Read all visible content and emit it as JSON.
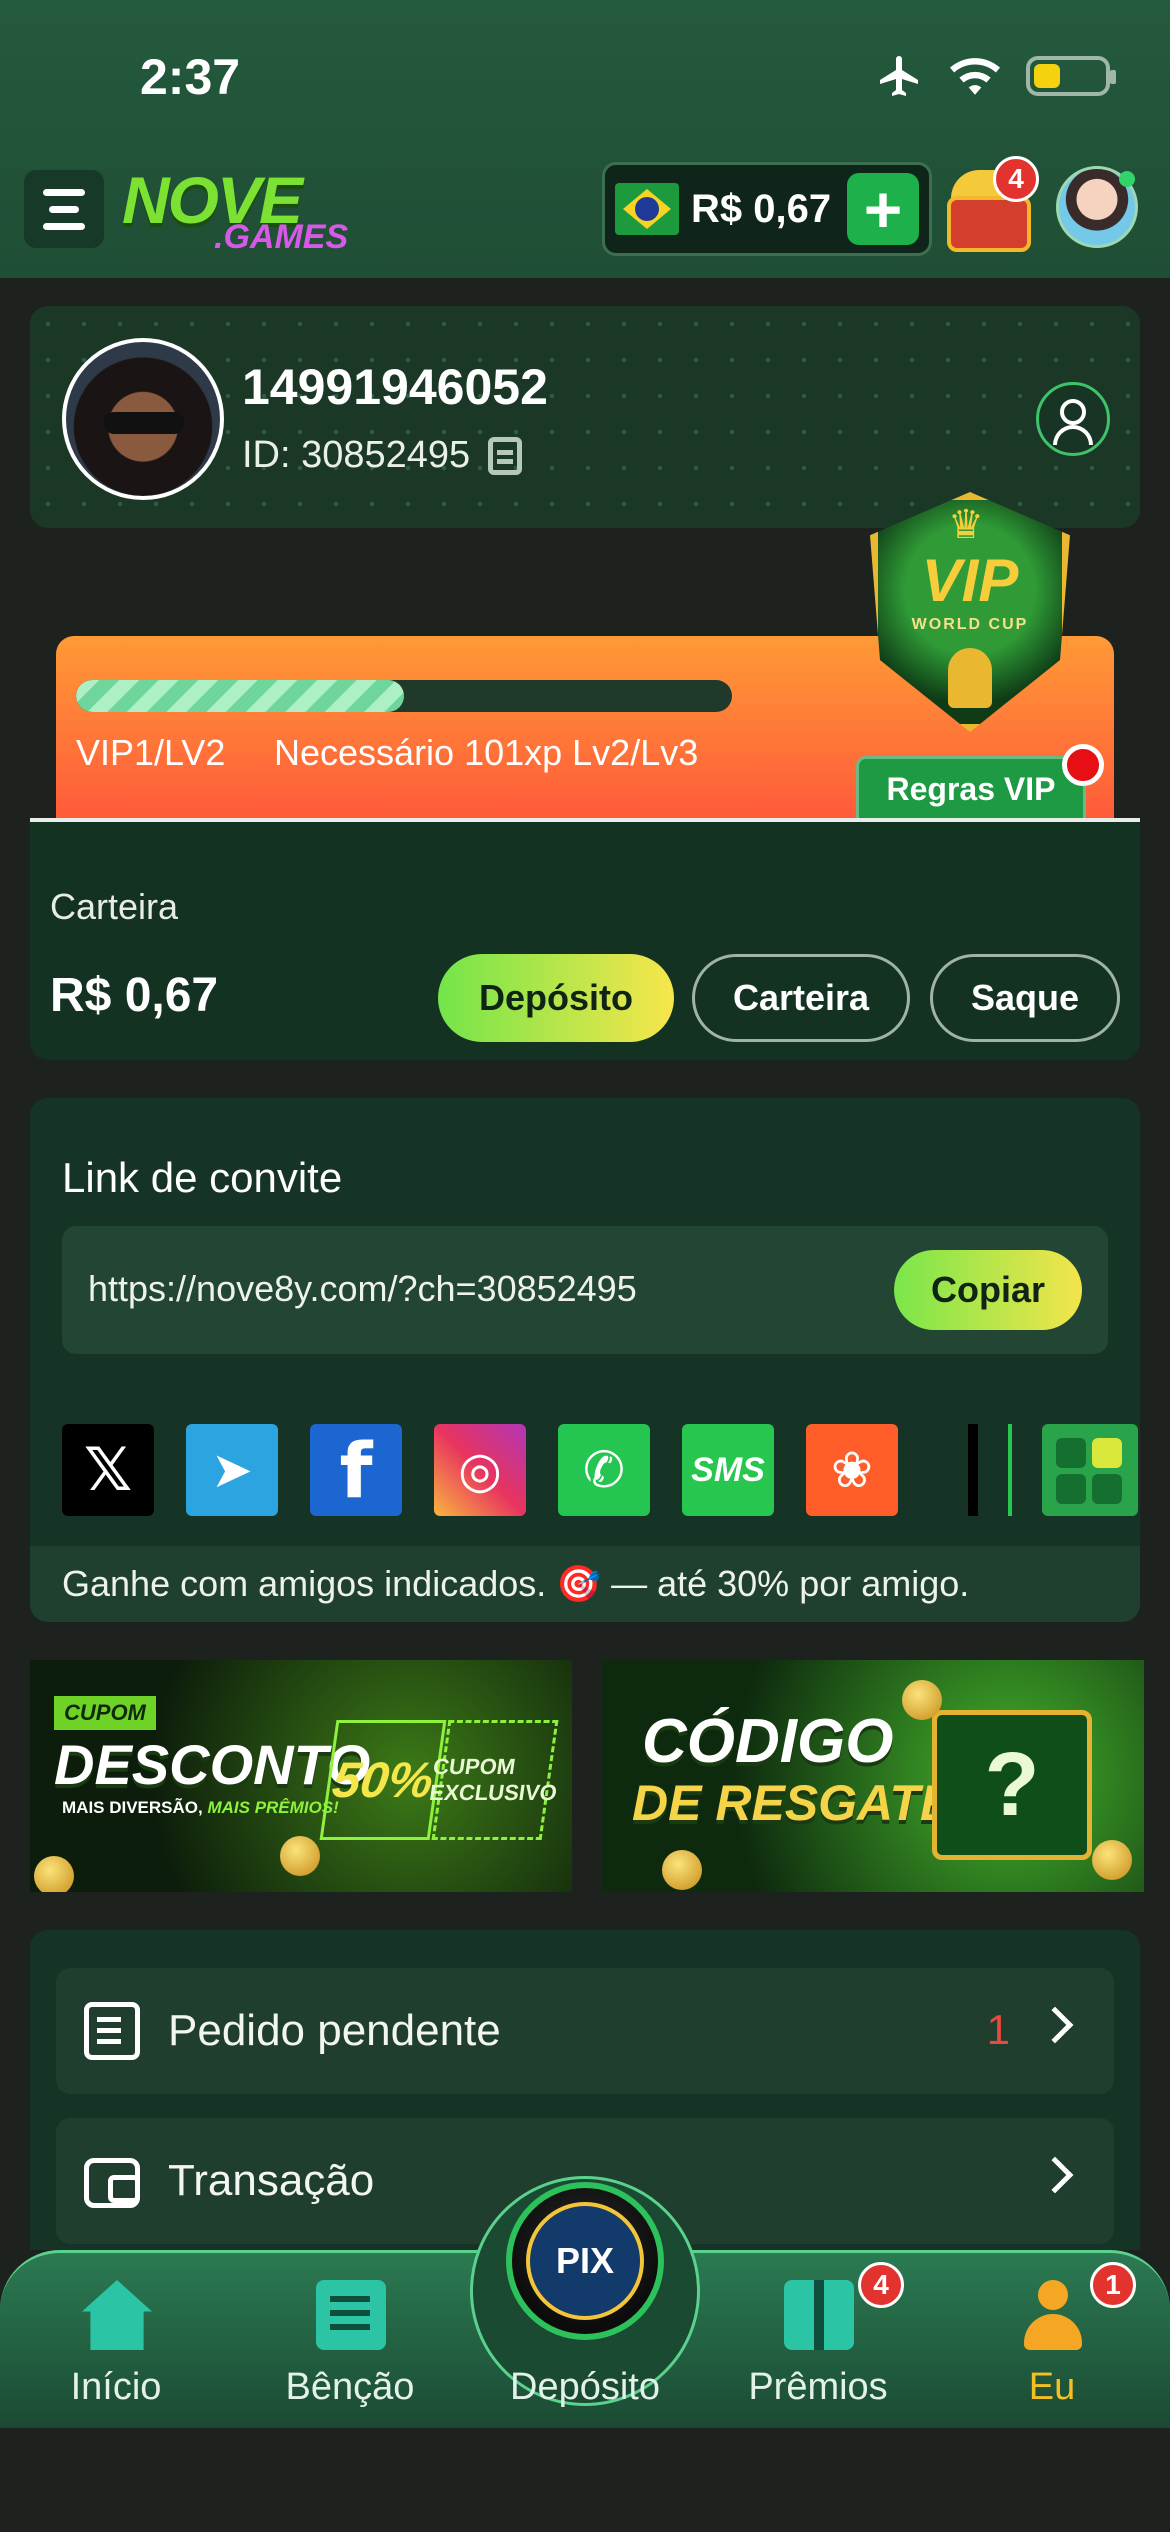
{
  "status_bar": {
    "time": "2:37",
    "icons": [
      "airplane-icon",
      "wifi-icon",
      "battery-icon"
    ],
    "battery_level": 0.25
  },
  "header": {
    "logo_top": "NOVE",
    "logo_bottom": ".GAMES",
    "balance": "R$ 0,67",
    "add_funds_symbol": "+",
    "chest_badge": "4"
  },
  "profile": {
    "username": "14991946052",
    "id_text": "ID: 30852495"
  },
  "vip": {
    "progress_fraction": 0.5,
    "level": "VIP1/LV2",
    "requirement": "Necessário 101xp Lv2/Lv3",
    "rules_button": "Regras VIP",
    "badge_title": "VIP",
    "badge_subtitle": "WORLD CUP",
    "badge_crown": "♛"
  },
  "wallet": {
    "label": "Carteira",
    "amount": "R$ 0,67",
    "buttons": {
      "deposit": "Depósito",
      "wallet": "Carteira",
      "withdraw": "Saque"
    }
  },
  "invite": {
    "title": "Link de convite",
    "url": "https://nove8y.com/?ch=30852495",
    "copy_button": "Copiar",
    "share_glyphs": {
      "x": "𝕏",
      "telegram": "➤",
      "facebook": "f",
      "instagram": "◎",
      "whatsapp": "✆",
      "sms": "SMS",
      "kwai": "❀"
    },
    "note": "Ganhe com amigos indicados. 🎯 — até 30% por amigo."
  },
  "banners": {
    "cupom": {
      "tag": "CUPOM",
      "title": "DESCONTO",
      "subtitle_plain": "MAIS DIVERSÃO, ",
      "subtitle_highlight": "MAIS PRÊMIOS!",
      "percent": "50%",
      "coupon": "CUPOM EXCLUSIVO"
    },
    "codigo": {
      "title_line1": "CÓDIGO",
      "title_line2": "DE RESGATE",
      "gift_mark": "?"
    }
  },
  "menu_list": {
    "items": [
      {
        "label": "Pedido pendente",
        "count": "1",
        "icon": "document-icon"
      },
      {
        "label": "Transação",
        "count": "",
        "icon": "wallet-icon"
      }
    ]
  },
  "bottom_nav": {
    "items": [
      {
        "label": "Início",
        "icon": "home-icon"
      },
      {
        "label": "Bênção",
        "icon": "clipboard-icon"
      },
      {
        "label": "Depósito",
        "icon": "pix-icon"
      },
      {
        "label": "Prêmios",
        "icon": "gift-icon",
        "badge": "4"
      },
      {
        "label": "Eu",
        "icon": "user-icon",
        "badge": "1",
        "active": true
      }
    ],
    "pix_label": "PIX"
  },
  "colors": {
    "accent_green": "#1db04b",
    "highlight_yellow": "#f5c024",
    "badge_red": "#e3332e"
  }
}
